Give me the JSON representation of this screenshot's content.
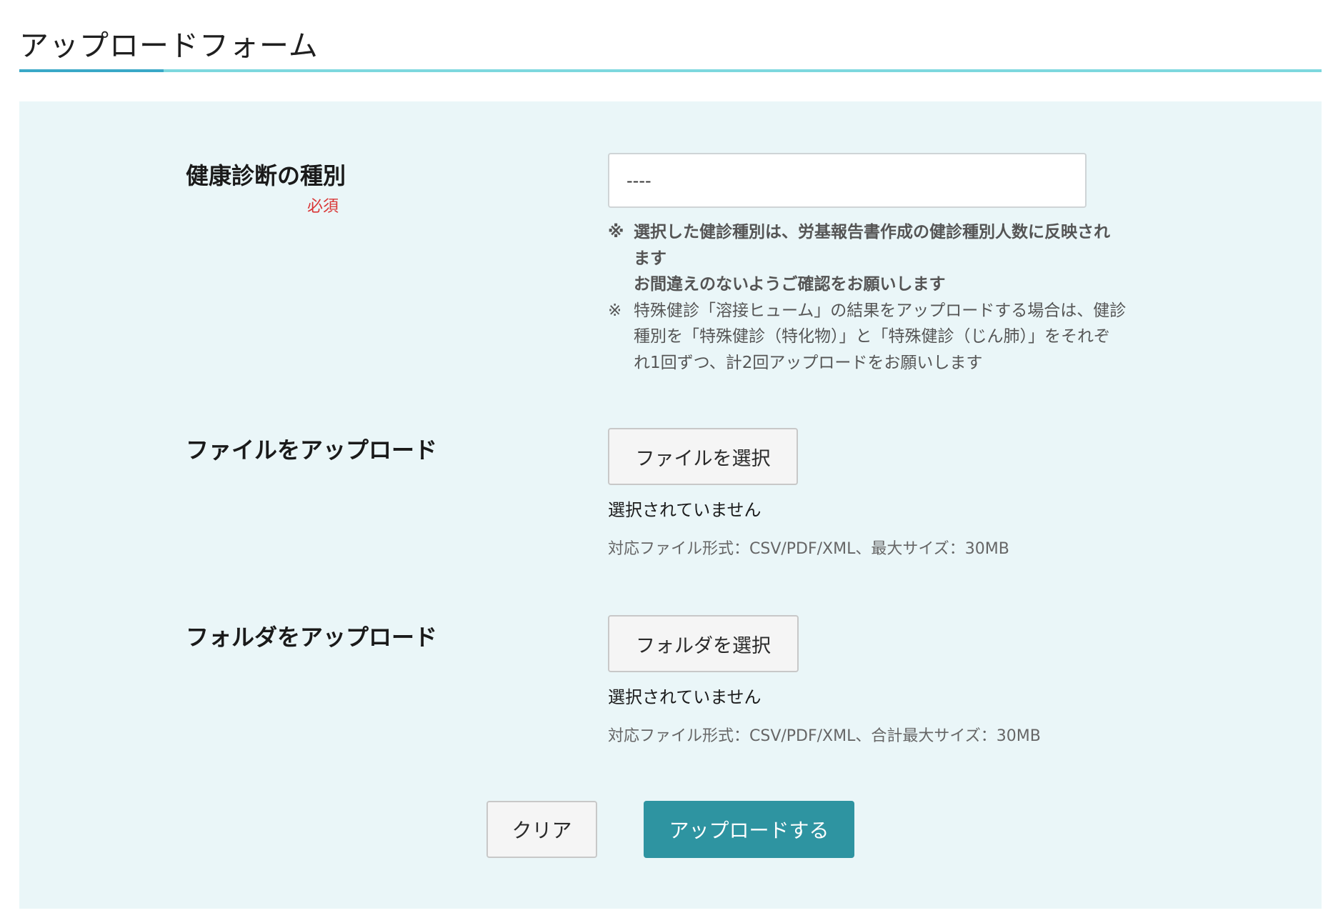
{
  "page": {
    "title": "アップロードフォーム"
  },
  "form": {
    "exam_type": {
      "label": "健康診断の種別",
      "required_label": "必須",
      "value": "----",
      "notes": [
        {
          "mark": "※",
          "lines": [
            "選択した健診種別は、労基報告書作成の健診種別人数に反映され",
            "ます",
            "お間違えのないようご確認をお願いします"
          ]
        },
        {
          "mark": "※",
          "lines": [
            "特殊健診「溶接ヒューム」の結果をアップロードする場合は、健診",
            "種別を「特殊健診（特化物）」と「特殊健診（じん肺）」をそれぞ",
            "れ1回ずつ、計2回アップロードをお願いします"
          ]
        }
      ]
    },
    "file_upload": {
      "label": "ファイルをアップロード",
      "button_label": "ファイルを選択",
      "status": "選択されていません",
      "hint": "対応ファイル形式：CSV/PDF/XML、最大サイズ：30MB"
    },
    "folder_upload": {
      "label": "フォルダをアップロード",
      "button_label": "フォルダを選択",
      "status": "選択されていません",
      "hint": "対応ファイル形式：CSV/PDF/XML、合計最大サイズ：30MB"
    },
    "actions": {
      "clear_label": "クリア",
      "submit_label": "アップロードする"
    }
  },
  "colors": {
    "accent": "#2e94a1",
    "panel_background": "#eaf6f8",
    "required": "#d93636"
  }
}
